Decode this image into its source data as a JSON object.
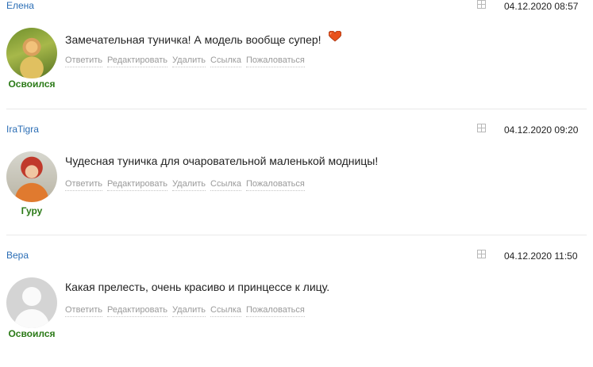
{
  "comments": [
    {
      "author": "Елена",
      "date": "04.12.2020 08:57",
      "rank": "Освоился",
      "text": "Замечательная туничка! А модель вообще супер!",
      "emoji": "heart-icon",
      "actions": [
        "Ответить",
        "Редактировать",
        "Удалить",
        "Ссылка",
        "Пожаловаться"
      ]
    },
    {
      "author": "IraTigra",
      "date": "04.12.2020 09:20",
      "rank": "Гуру",
      "text": "Чудесная туничка для очаровательной маленькой модницы!",
      "actions": [
        "Ответить",
        "Редактировать",
        "Удалить",
        "Ссылка",
        "Пожаловаться"
      ]
    },
    {
      "author": "Вера",
      "date": "04.12.2020 11:50",
      "rank": "Освоился",
      "text": "Какая прелесть, очень красиво и принцессе к лицу.",
      "actions": [
        "Ответить",
        "Редактировать",
        "Удалить",
        "Ссылка",
        "Пожаловаться"
      ]
    }
  ],
  "colors": {
    "author_link": "#2a6db5",
    "rank": "#2b7a17",
    "action": "#9a9a9a"
  }
}
